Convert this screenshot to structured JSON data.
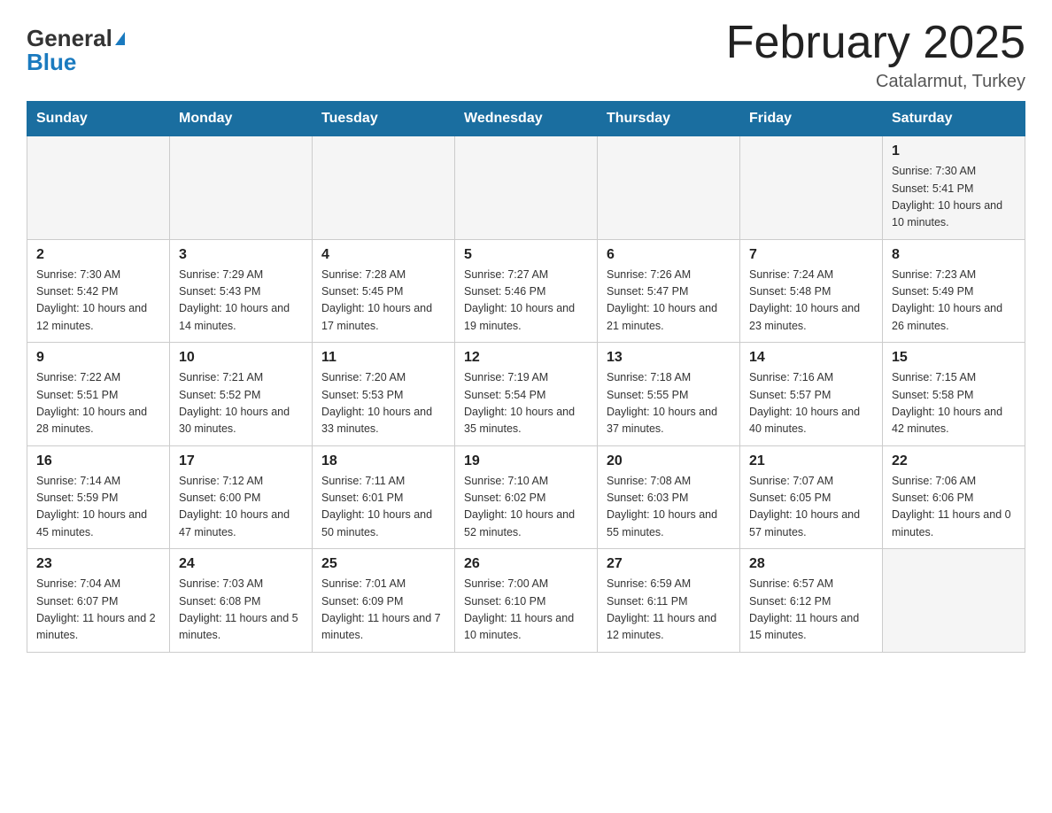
{
  "header": {
    "logo_general": "General",
    "logo_blue": "Blue",
    "month_title": "February 2025",
    "location": "Catalarmut, Turkey"
  },
  "days_of_week": [
    "Sunday",
    "Monday",
    "Tuesday",
    "Wednesday",
    "Thursday",
    "Friday",
    "Saturday"
  ],
  "weeks": [
    {
      "days": [
        {
          "number": "",
          "sunrise": "",
          "sunset": "",
          "daylight": ""
        },
        {
          "number": "",
          "sunrise": "",
          "sunset": "",
          "daylight": ""
        },
        {
          "number": "",
          "sunrise": "",
          "sunset": "",
          "daylight": ""
        },
        {
          "number": "",
          "sunrise": "",
          "sunset": "",
          "daylight": ""
        },
        {
          "number": "",
          "sunrise": "",
          "sunset": "",
          "daylight": ""
        },
        {
          "number": "",
          "sunrise": "",
          "sunset": "",
          "daylight": ""
        },
        {
          "number": "1",
          "sunrise": "Sunrise: 7:30 AM",
          "sunset": "Sunset: 5:41 PM",
          "daylight": "Daylight: 10 hours and 10 minutes."
        }
      ]
    },
    {
      "days": [
        {
          "number": "2",
          "sunrise": "Sunrise: 7:30 AM",
          "sunset": "Sunset: 5:42 PM",
          "daylight": "Daylight: 10 hours and 12 minutes."
        },
        {
          "number": "3",
          "sunrise": "Sunrise: 7:29 AM",
          "sunset": "Sunset: 5:43 PM",
          "daylight": "Daylight: 10 hours and 14 minutes."
        },
        {
          "number": "4",
          "sunrise": "Sunrise: 7:28 AM",
          "sunset": "Sunset: 5:45 PM",
          "daylight": "Daylight: 10 hours and 17 minutes."
        },
        {
          "number": "5",
          "sunrise": "Sunrise: 7:27 AM",
          "sunset": "Sunset: 5:46 PM",
          "daylight": "Daylight: 10 hours and 19 minutes."
        },
        {
          "number": "6",
          "sunrise": "Sunrise: 7:26 AM",
          "sunset": "Sunset: 5:47 PM",
          "daylight": "Daylight: 10 hours and 21 minutes."
        },
        {
          "number": "7",
          "sunrise": "Sunrise: 7:24 AM",
          "sunset": "Sunset: 5:48 PM",
          "daylight": "Daylight: 10 hours and 23 minutes."
        },
        {
          "number": "8",
          "sunrise": "Sunrise: 7:23 AM",
          "sunset": "Sunset: 5:49 PM",
          "daylight": "Daylight: 10 hours and 26 minutes."
        }
      ]
    },
    {
      "days": [
        {
          "number": "9",
          "sunrise": "Sunrise: 7:22 AM",
          "sunset": "Sunset: 5:51 PM",
          "daylight": "Daylight: 10 hours and 28 minutes."
        },
        {
          "number": "10",
          "sunrise": "Sunrise: 7:21 AM",
          "sunset": "Sunset: 5:52 PM",
          "daylight": "Daylight: 10 hours and 30 minutes."
        },
        {
          "number": "11",
          "sunrise": "Sunrise: 7:20 AM",
          "sunset": "Sunset: 5:53 PM",
          "daylight": "Daylight: 10 hours and 33 minutes."
        },
        {
          "number": "12",
          "sunrise": "Sunrise: 7:19 AM",
          "sunset": "Sunset: 5:54 PM",
          "daylight": "Daylight: 10 hours and 35 minutes."
        },
        {
          "number": "13",
          "sunrise": "Sunrise: 7:18 AM",
          "sunset": "Sunset: 5:55 PM",
          "daylight": "Daylight: 10 hours and 37 minutes."
        },
        {
          "number": "14",
          "sunrise": "Sunrise: 7:16 AM",
          "sunset": "Sunset: 5:57 PM",
          "daylight": "Daylight: 10 hours and 40 minutes."
        },
        {
          "number": "15",
          "sunrise": "Sunrise: 7:15 AM",
          "sunset": "Sunset: 5:58 PM",
          "daylight": "Daylight: 10 hours and 42 minutes."
        }
      ]
    },
    {
      "days": [
        {
          "number": "16",
          "sunrise": "Sunrise: 7:14 AM",
          "sunset": "Sunset: 5:59 PM",
          "daylight": "Daylight: 10 hours and 45 minutes."
        },
        {
          "number": "17",
          "sunrise": "Sunrise: 7:12 AM",
          "sunset": "Sunset: 6:00 PM",
          "daylight": "Daylight: 10 hours and 47 minutes."
        },
        {
          "number": "18",
          "sunrise": "Sunrise: 7:11 AM",
          "sunset": "Sunset: 6:01 PM",
          "daylight": "Daylight: 10 hours and 50 minutes."
        },
        {
          "number": "19",
          "sunrise": "Sunrise: 7:10 AM",
          "sunset": "Sunset: 6:02 PM",
          "daylight": "Daylight: 10 hours and 52 minutes."
        },
        {
          "number": "20",
          "sunrise": "Sunrise: 7:08 AM",
          "sunset": "Sunset: 6:03 PM",
          "daylight": "Daylight: 10 hours and 55 minutes."
        },
        {
          "number": "21",
          "sunrise": "Sunrise: 7:07 AM",
          "sunset": "Sunset: 6:05 PM",
          "daylight": "Daylight: 10 hours and 57 minutes."
        },
        {
          "number": "22",
          "sunrise": "Sunrise: 7:06 AM",
          "sunset": "Sunset: 6:06 PM",
          "daylight": "Daylight: 11 hours and 0 minutes."
        }
      ]
    },
    {
      "days": [
        {
          "number": "23",
          "sunrise": "Sunrise: 7:04 AM",
          "sunset": "Sunset: 6:07 PM",
          "daylight": "Daylight: 11 hours and 2 minutes."
        },
        {
          "number": "24",
          "sunrise": "Sunrise: 7:03 AM",
          "sunset": "Sunset: 6:08 PM",
          "daylight": "Daylight: 11 hours and 5 minutes."
        },
        {
          "number": "25",
          "sunrise": "Sunrise: 7:01 AM",
          "sunset": "Sunset: 6:09 PM",
          "daylight": "Daylight: 11 hours and 7 minutes."
        },
        {
          "number": "26",
          "sunrise": "Sunrise: 7:00 AM",
          "sunset": "Sunset: 6:10 PM",
          "daylight": "Daylight: 11 hours and 10 minutes."
        },
        {
          "number": "27",
          "sunrise": "Sunrise: 6:59 AM",
          "sunset": "Sunset: 6:11 PM",
          "daylight": "Daylight: 11 hours and 12 minutes."
        },
        {
          "number": "28",
          "sunrise": "Sunrise: 6:57 AM",
          "sunset": "Sunset: 6:12 PM",
          "daylight": "Daylight: 11 hours and 15 minutes."
        },
        {
          "number": "",
          "sunrise": "",
          "sunset": "",
          "daylight": ""
        }
      ]
    }
  ]
}
